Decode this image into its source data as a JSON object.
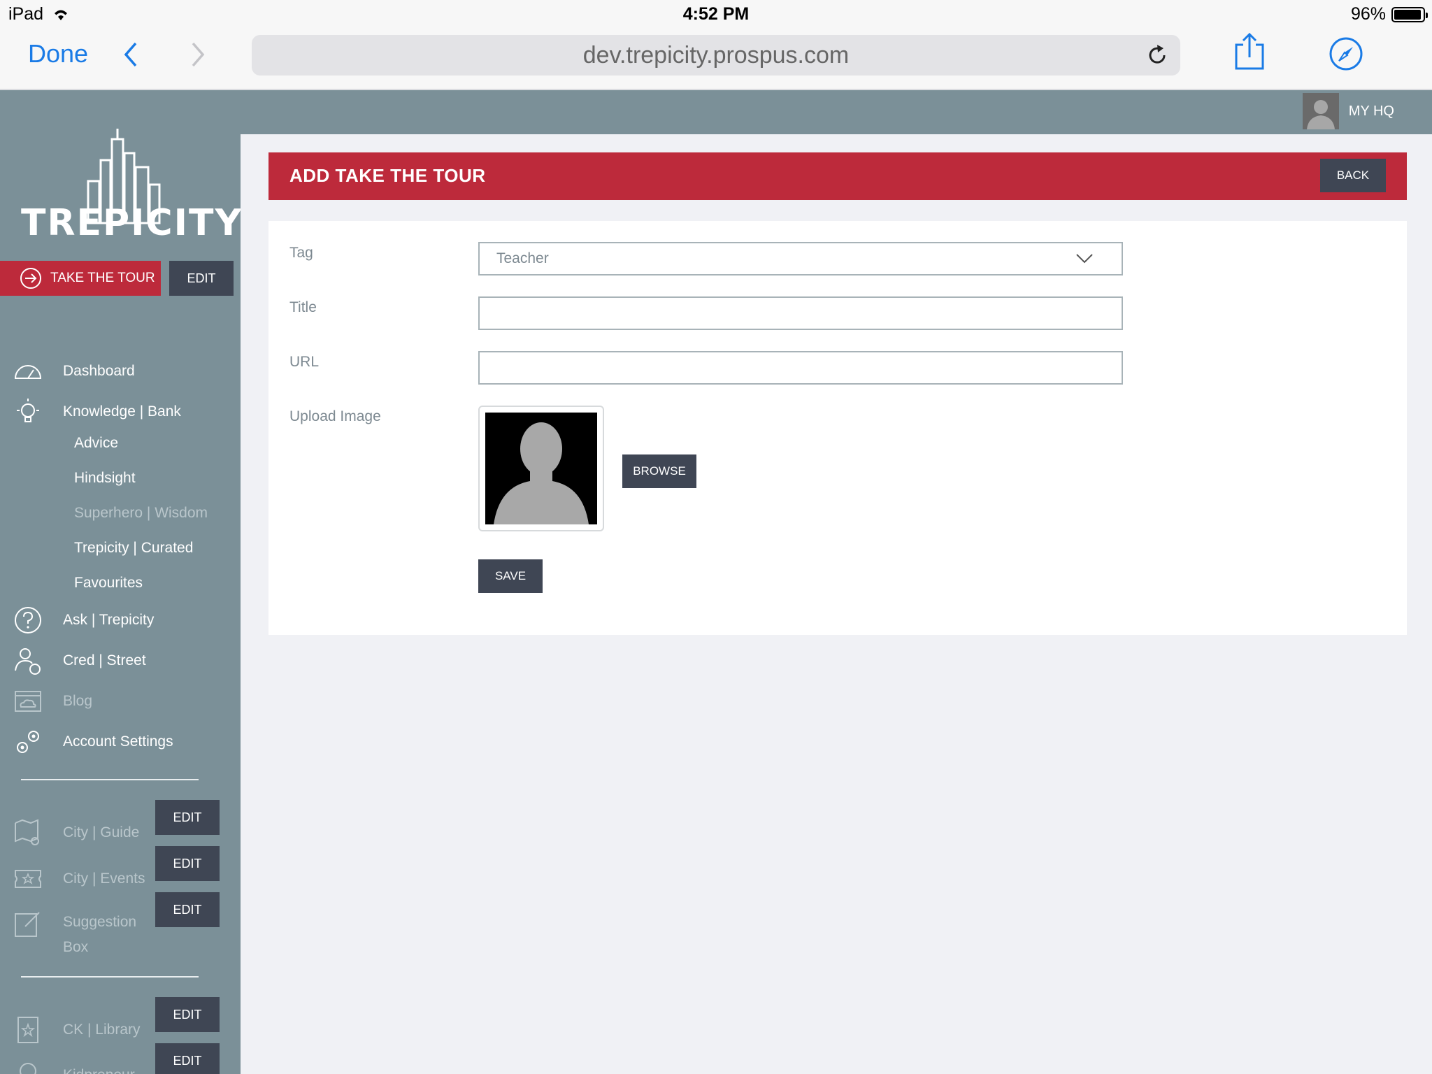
{
  "status_bar": {
    "device": "iPad",
    "time": "4:52 PM",
    "battery": "96%",
    "battery_level": 0.96
  },
  "browser": {
    "done_label": "Done",
    "url": "dev.trepicity.prospus.com"
  },
  "account": {
    "label": "MY HQ"
  },
  "logo": {
    "text": "TREPICITY"
  },
  "sidebar": {
    "tour_label": "TAKE THE TOUR",
    "tour_edit": "EDIT",
    "items": [
      {
        "label": "Dashboard",
        "icon": "speedometer-icon"
      },
      {
        "label": "Knowledge | Bank",
        "icon": "lightbulb-icon"
      },
      {
        "label": "Ask | Trepicity",
        "icon": "question-icon"
      },
      {
        "label": "Cred | Street",
        "icon": "user-money-icon"
      },
      {
        "label": "Blog",
        "icon": "cloud-window-icon"
      },
      {
        "label": "Account Settings",
        "icon": "gears-icon"
      }
    ],
    "subitems": [
      "Advice",
      "Hindsight",
      "Superhero | Wisdom",
      "Trepicity | Curated",
      "Favourites"
    ],
    "locked_items": [
      {
        "label": "City | Guide",
        "icon": "map-pin-icon",
        "edit": "EDIT"
      },
      {
        "label": "City | Events",
        "icon": "ticket-icon",
        "edit": "EDIT"
      },
      {
        "label": "Suggestion",
        "label2": "Box",
        "icon": "pencil-note-icon",
        "edit": "EDIT"
      },
      {
        "label": "CK | Library",
        "icon": "book-star-icon",
        "edit": "EDIT"
      },
      {
        "label": "Kidpreneur",
        "icon": "badge-icon",
        "edit": "EDIT"
      }
    ]
  },
  "page": {
    "title": "ADD TAKE THE TOUR",
    "back_label": "BACK",
    "form": {
      "tag_label": "Tag",
      "tag_value": "Teacher",
      "title_label": "Title",
      "title_value": "",
      "url_label": "URL",
      "url_value": "",
      "upload_label": "Upload Image",
      "browse_label": "BROWSE",
      "save_label": "SAVE"
    }
  },
  "colors": {
    "sidebar": "#7b9098",
    "accent_red": "#bd2a3b",
    "dark_button": "#3f4654",
    "ios_blue": "#1a7be6"
  }
}
